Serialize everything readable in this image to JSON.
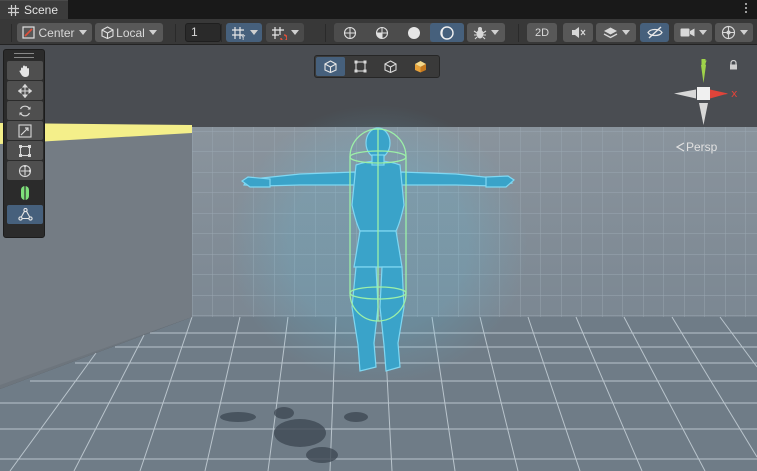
{
  "tab": {
    "icon": "grid-icon",
    "label": "Scene"
  },
  "toolbar": {
    "pivot_mode": "Center",
    "pivot_rotation": "Local",
    "grid_snap_value": "1",
    "mode_2d": "2D"
  },
  "overlay_buttons": [
    "wireframe-cube-icon",
    "rect-select-icon",
    "cube-icon",
    "shaded-cube-icon"
  ],
  "tools": [
    "hand-tool",
    "move-tool",
    "rotate-tool",
    "scale-tool",
    "rect-tool",
    "transform-tool",
    "collider-edit-tool",
    "bone-tool"
  ],
  "gizmo": {
    "x_label": "x",
    "y_label": "y",
    "projection": "Persp"
  },
  "colors": {
    "accent": "#46607c",
    "axis_x": "#e0443a",
    "axis_y": "#9fd34a",
    "character": "#3aa3c9",
    "collider": "#9cf0a8",
    "sky": "#4a4d52",
    "grid_wall": "#7f8a94",
    "floor": "#6e7b86",
    "light_strip": "#f4ef8a"
  }
}
